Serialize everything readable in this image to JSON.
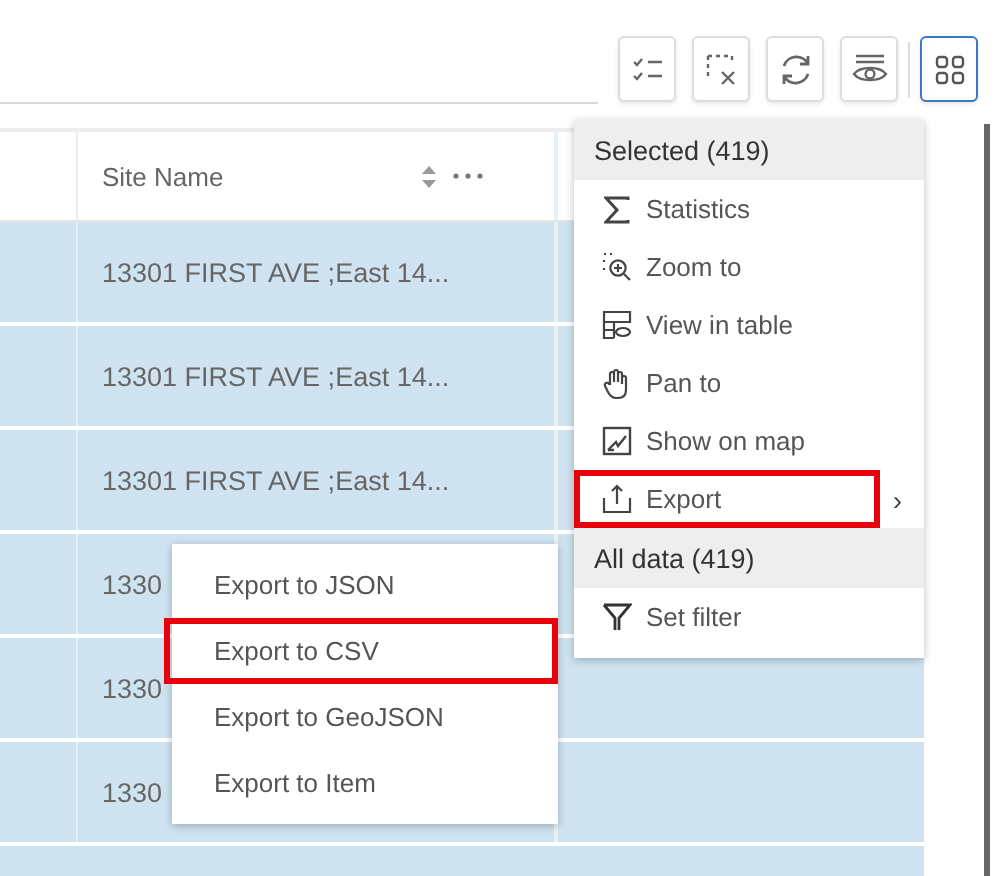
{
  "toolbar": {
    "buttons": [
      {
        "kind": "checklist"
      },
      {
        "kind": "clear-selection"
      },
      {
        "kind": "refresh"
      },
      {
        "kind": "visibility"
      }
    ],
    "menu_button": {
      "kind": "grid",
      "expanded": true
    }
  },
  "table": {
    "columns": [
      {
        "label": "Site Name"
      }
    ],
    "rows": [
      {
        "site_name": "13301 FIRST AVE ;East 14...",
        "selected": true
      },
      {
        "site_name": "13301 FIRST AVE ;East 14...",
        "selected": true
      },
      {
        "site_name": "13301 FIRST AVE ;East 14...",
        "selected": true
      },
      {
        "site_name": "1330",
        "selected": true
      },
      {
        "site_name": "1330",
        "selected": true
      },
      {
        "site_name": "1330",
        "selected": true
      }
    ]
  },
  "menu": {
    "sections": [
      {
        "title": "Selected (419)",
        "items": [
          {
            "kind": "statistics",
            "label": "Statistics",
            "highlighted": false,
            "submenu": false
          },
          {
            "kind": "zoom",
            "label": "Zoom to",
            "highlighted": false,
            "submenu": false
          },
          {
            "kind": "table",
            "label": "View in table",
            "highlighted": false,
            "submenu": false
          },
          {
            "kind": "pan",
            "label": "Pan to",
            "highlighted": false,
            "submenu": false
          },
          {
            "kind": "map",
            "label": "Show on map",
            "highlighted": false,
            "submenu": false
          },
          {
            "kind": "export",
            "label": "Export",
            "highlighted": true,
            "submenu": true
          }
        ]
      },
      {
        "title": "All data (419)",
        "items": [
          {
            "kind": "filter",
            "label": "Set filter",
            "highlighted": false,
            "submenu": false
          }
        ]
      }
    ],
    "submenu_arrow": "›"
  },
  "submenu": {
    "items": [
      {
        "label": "Export to JSON",
        "highlighted": false
      },
      {
        "label": "Export to CSV",
        "highlighted": true
      },
      {
        "label": "Export to GeoJSON",
        "highlighted": false
      },
      {
        "label": "Export to Item",
        "highlighted": false
      }
    ]
  }
}
